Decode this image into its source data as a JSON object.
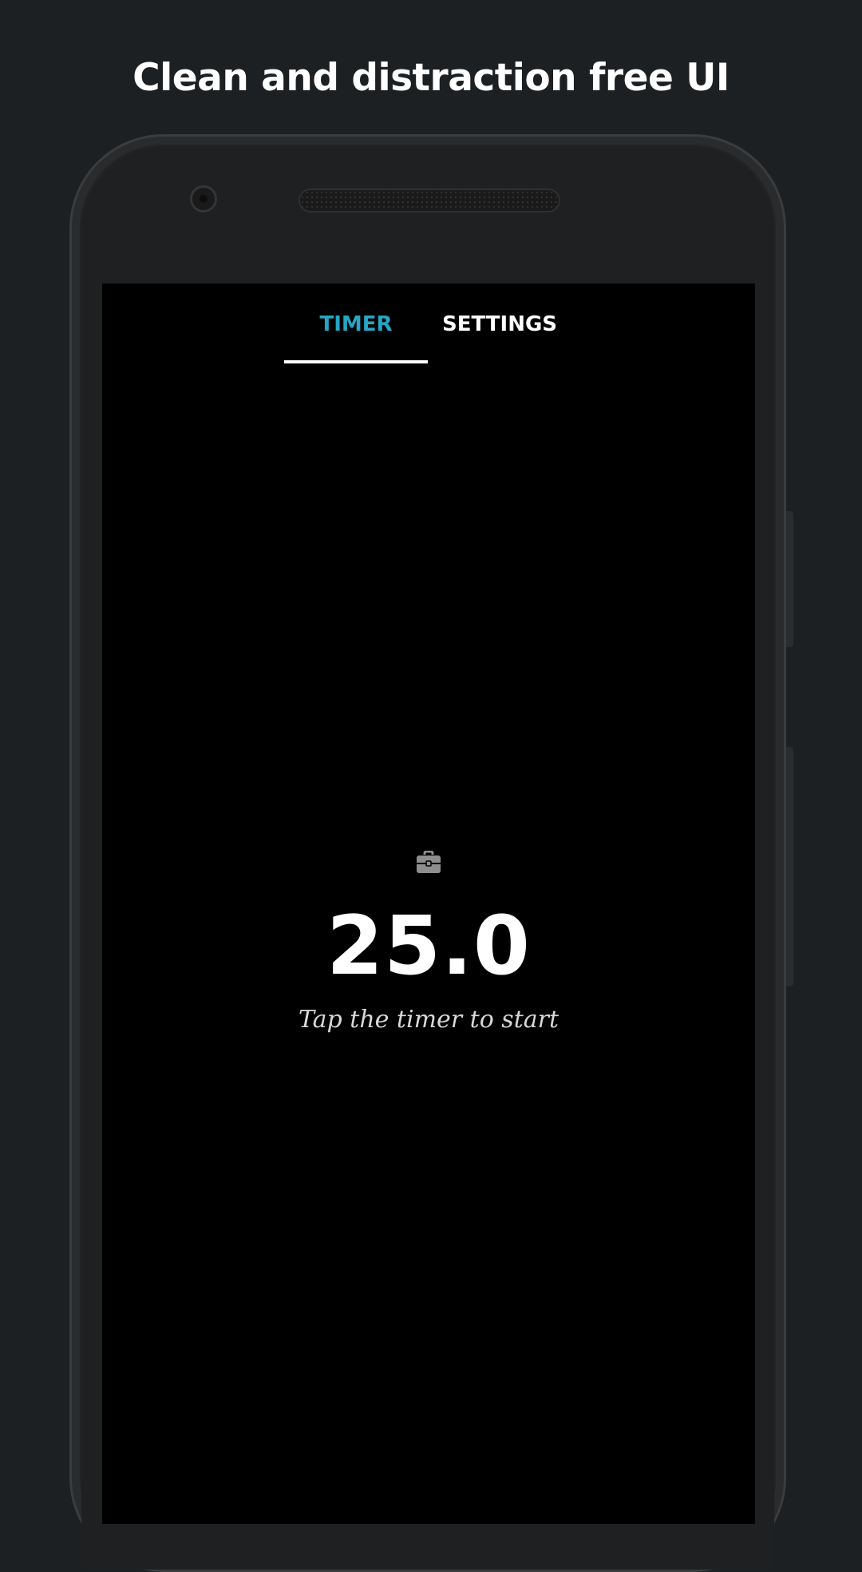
{
  "headline": "Clean and distraction free UI",
  "tabs": [
    {
      "label": "TIMER",
      "active": true
    },
    {
      "label": "SETTINGS",
      "active": false
    }
  ],
  "timer": {
    "icon": "briefcase-icon",
    "value": "25.0",
    "hint": "Tap the timer to start"
  },
  "colors": {
    "background": "#1c2022",
    "screen": "#000000",
    "accent": "#26a5c4",
    "text": "#ffffff"
  }
}
